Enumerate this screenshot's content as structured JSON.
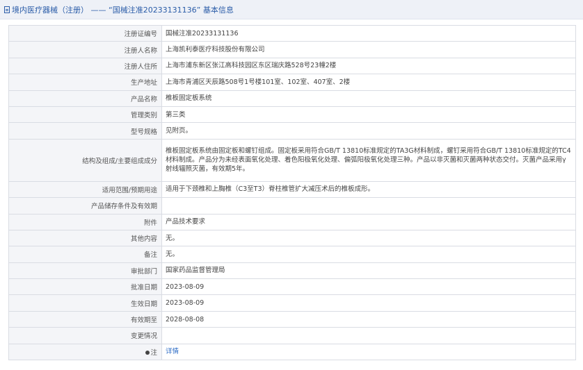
{
  "header": {
    "title": "境内医疗器械（注册） —— “国械注准20233131136” 基本信息"
  },
  "rows": [
    {
      "label": "注册证编号",
      "value": "国械注准20233131136"
    },
    {
      "label": "注册人名称",
      "value": "上海凯利泰医疗科技股份有限公司"
    },
    {
      "label": "注册人住所",
      "value": "上海市浦东新区张江高科技园区东区瑞庆路528号23幢2楼"
    },
    {
      "label": "生产地址",
      "value": "上海市青浦区天辰路508号1号楼101室、102室、407室、2楼"
    },
    {
      "label": "产品名称",
      "value": "椎板固定板系统"
    },
    {
      "label": "管理类别",
      "value": "第三类"
    },
    {
      "label": "型号规格",
      "value": "见附页。"
    },
    {
      "label": "结构及组成/主要组成成分",
      "value": "椎板固定板系统由固定板和螺钉组成。固定板采用符合GB/T 13810标准规定的TA3G材料制成，螺钉采用符合GB/T 13810标准规定的TC4材料制成。产品分为未经表面氧化处理、着色阳极氧化处理、偏弧阳极氧化处理三种。产品以非灭菌和灭菌两种状态交付。灭菌产品采用γ射线辐照灭菌，有效期5年。"
    },
    {
      "label": "适用范围/预期用途",
      "value": "适用于下颈椎和上胸椎（C3至T3）脊柱椎管扩大减压术后的椎板成形。"
    },
    {
      "label": "产品储存条件及有效期",
      "value": ""
    },
    {
      "label": "附件",
      "value": "产品技术要求"
    },
    {
      "label": "其他内容",
      "value": "无。"
    },
    {
      "label": "备注",
      "value": "无。"
    },
    {
      "label": "审批部门",
      "value": "国家药品监督管理局"
    },
    {
      "label": "批准日期",
      "value": "2023-08-09"
    },
    {
      "label": "生效日期",
      "value": "2023-08-09"
    },
    {
      "label": "有效期至",
      "value": "2028-08-08"
    },
    {
      "label": "变更情况",
      "value": ""
    },
    {
      "label": "注",
      "value": "详情"
    }
  ]
}
